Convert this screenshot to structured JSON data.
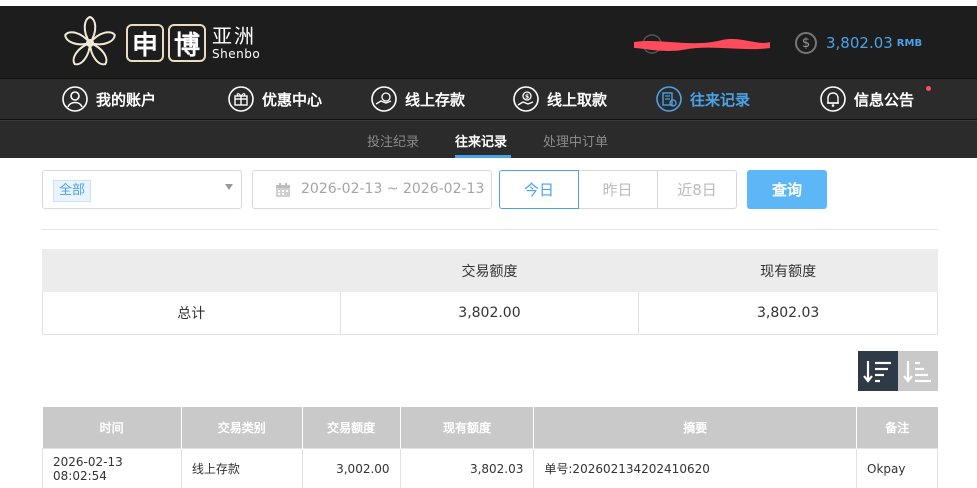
{
  "brand": {
    "char1": "申",
    "char2": "博",
    "cn_name": "亚洲",
    "en_name": "Shenbo"
  },
  "account": {
    "balance": "3,802.03",
    "currency": "RMB"
  },
  "colors": {
    "accent": "#4aa3e8",
    "header_bg": "#1d1d1d",
    "nav_bg": "#2b2b2b",
    "button_bg": "#5db6f6",
    "redaction": "#ff4b5c"
  },
  "nav": {
    "items": [
      {
        "label": "我的账户",
        "icon": "user-icon"
      },
      {
        "label": "优惠中心",
        "icon": "gift-icon"
      },
      {
        "label": "线上存款",
        "icon": "deposit-icon"
      },
      {
        "label": "线上取款",
        "icon": "withdraw-icon"
      },
      {
        "label": "往来记录",
        "icon": "records-icon",
        "active": true
      },
      {
        "label": "信息公告",
        "icon": "bell-icon"
      }
    ]
  },
  "subnav": {
    "items": [
      "投注纪录",
      "往来记录",
      "处理中订单"
    ],
    "active": "往来记录"
  },
  "filters": {
    "type_selected": "全部",
    "date_range": "2026-02-13 ~ 2026-02-13",
    "quick": [
      "今日",
      "昨日",
      "近8日"
    ],
    "quick_active": "今日",
    "query_label": "查询"
  },
  "summary": {
    "headers": [
      "",
      "交易额度",
      "现有额度"
    ],
    "row": [
      "总计",
      "3,802.00",
      "3,802.03"
    ]
  },
  "records": {
    "headers": [
      "时间",
      "交易类别",
      "交易额度",
      "现有额度",
      "摘要",
      "备注"
    ],
    "rows": [
      [
        "2026-02-13 08:02:54",
        "线上存款",
        "3,002.00",
        "3,802.03",
        "单号:202602134202410620",
        "Okpay"
      ]
    ]
  }
}
